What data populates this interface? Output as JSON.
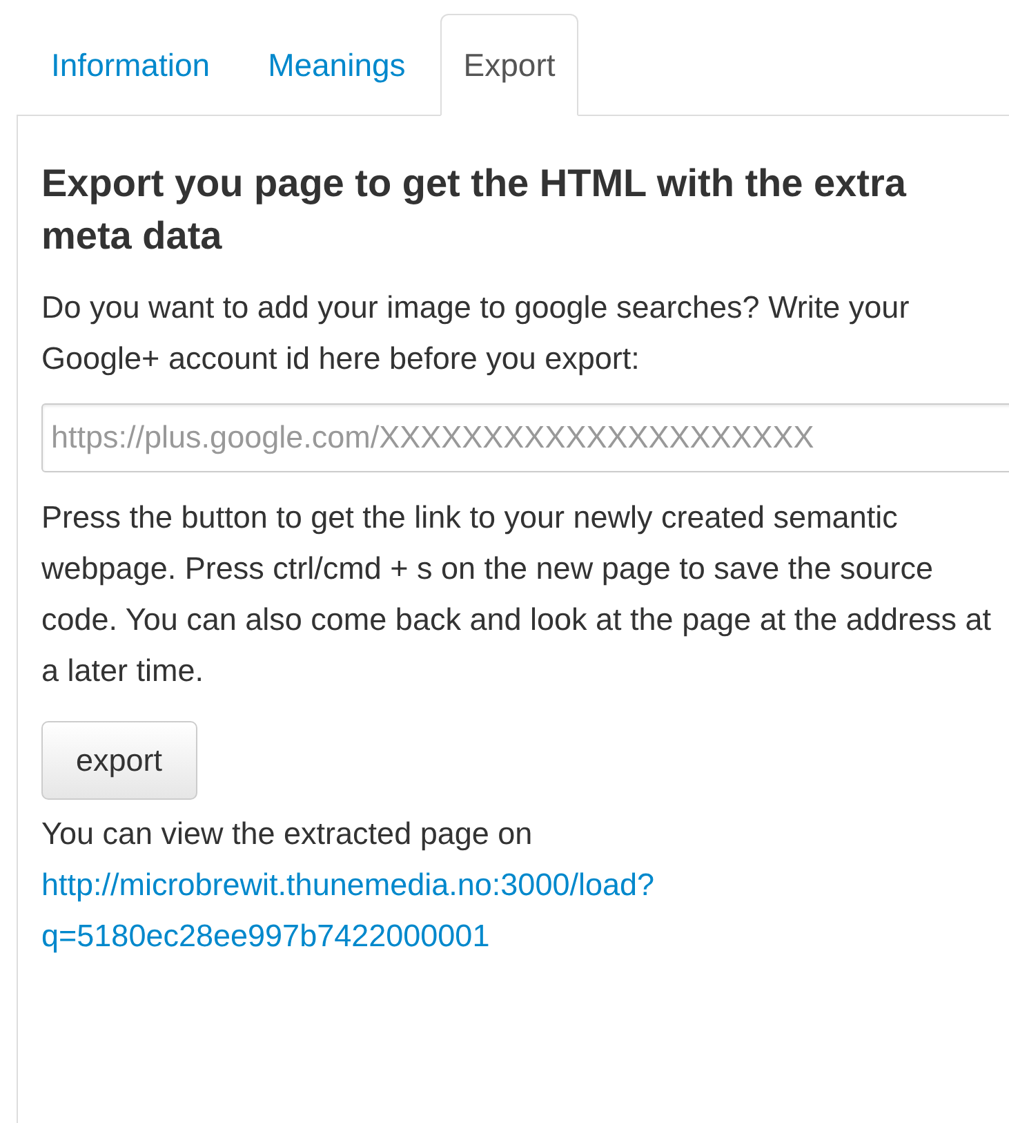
{
  "tabs": [
    {
      "label": "Information",
      "selected": false
    },
    {
      "label": "Meanings",
      "selected": false
    },
    {
      "label": "Export",
      "selected": true
    }
  ],
  "panel": {
    "heading": "Export you page to get the HTML with the extra meta data",
    "intro": "Do you want to add your image to google searches? Write your Google+ account id here before you export:",
    "account_field": {
      "placeholder": "https://plus.google.com/XXXXXXXXXXXXXXXXXXXXX"
    },
    "instructions": "Press the button to get the link to your newly created semantic webpage. Press ctrl/cmd + s on the new page to save the source code. You can also come back and look at the page at the address at a later time.",
    "button": "export",
    "result_text": "You can view the extracted page on",
    "result_link": "http://microbrewit.thunemedia.no:3000/load?q=5180ec28ee997b7422000001"
  }
}
